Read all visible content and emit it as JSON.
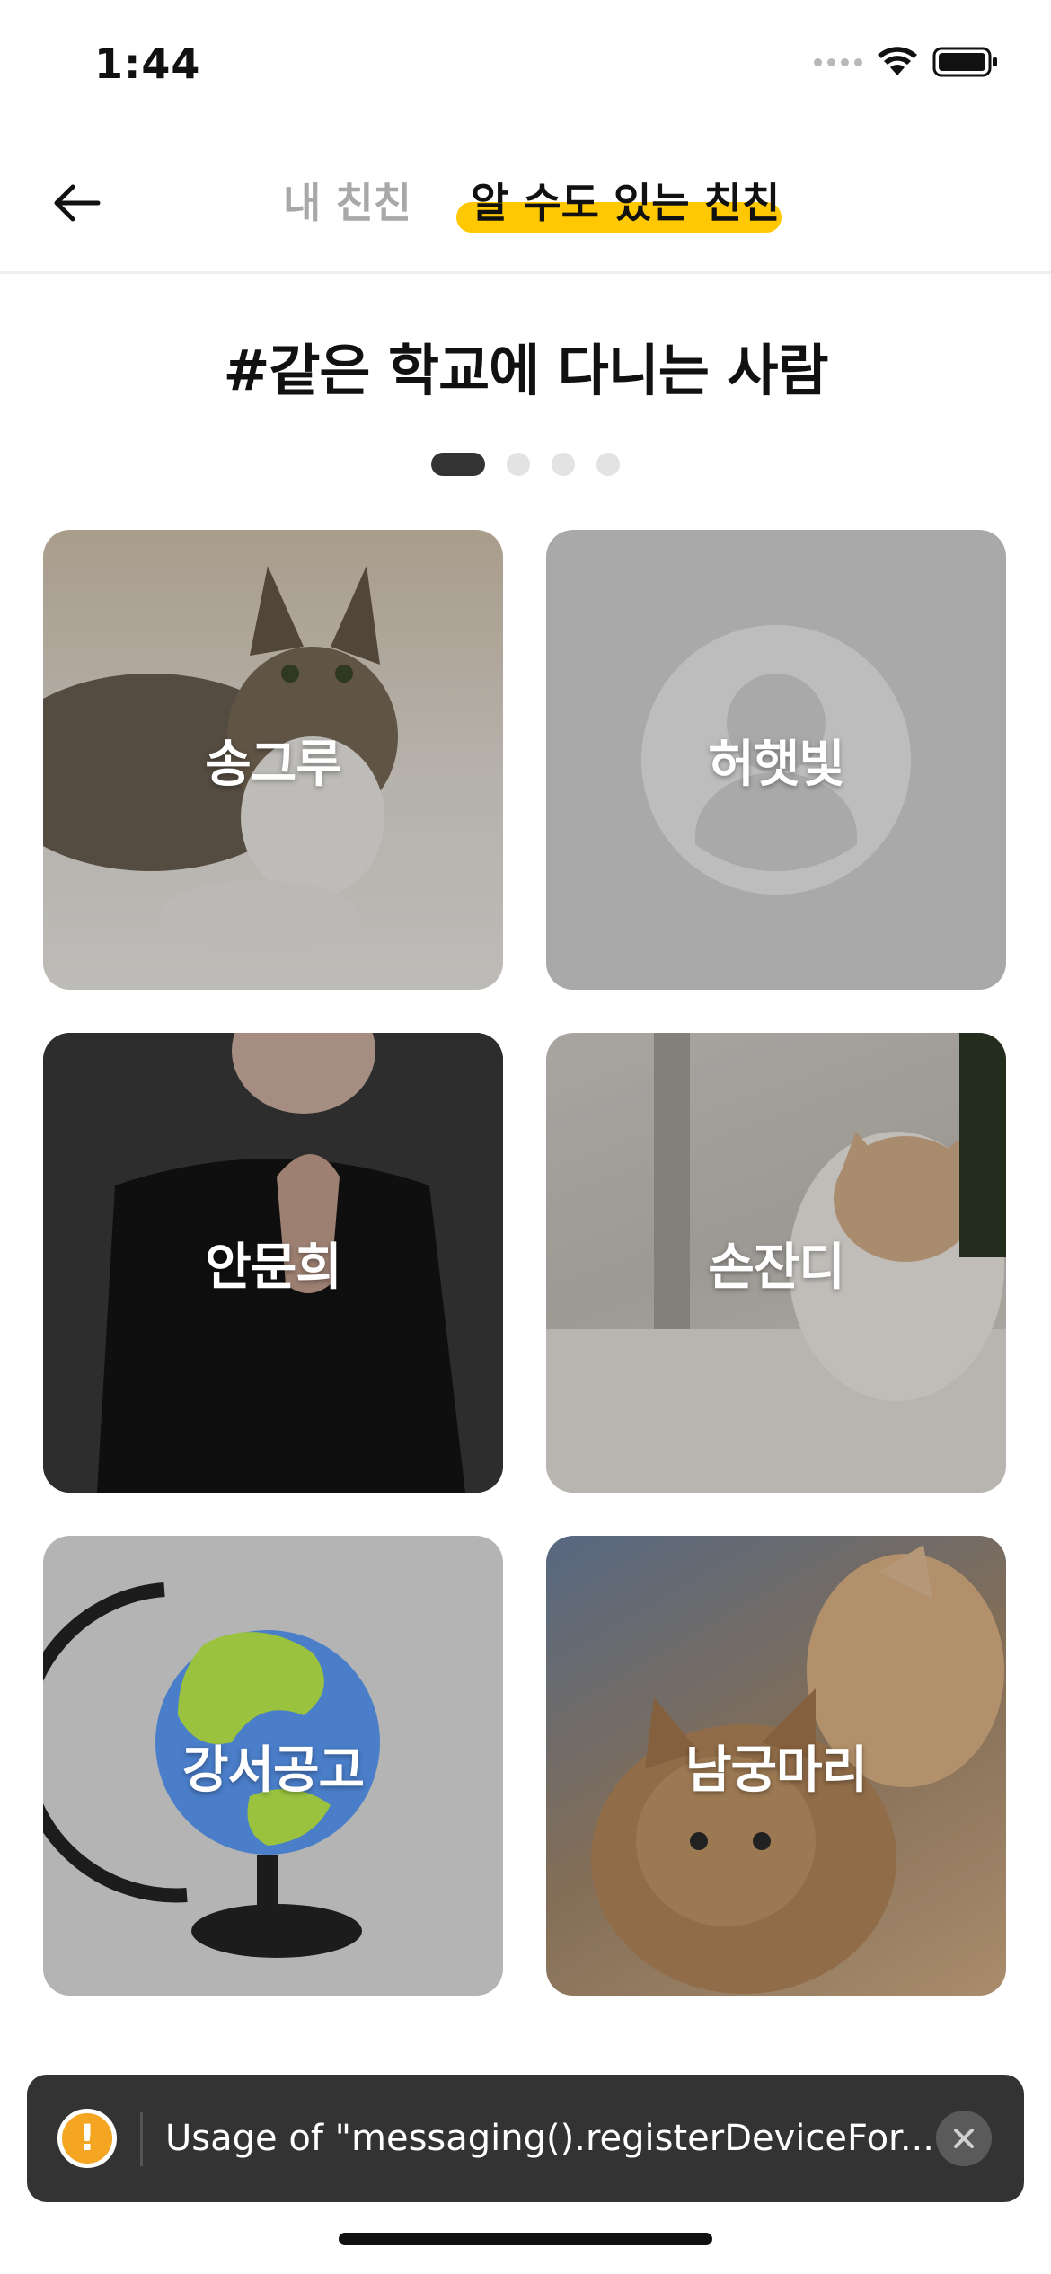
{
  "status_bar": {
    "time": "1:44",
    "icons": [
      "cellular-signal-icon",
      "wifi-icon",
      "battery-icon"
    ]
  },
  "header": {
    "back_icon": "arrow-left-icon",
    "tabs": [
      {
        "label": "내 친친",
        "active": false
      },
      {
        "label": "알 수도 있는 친친",
        "active": true
      }
    ],
    "active_color": "#ffc801"
  },
  "section": {
    "title": "#같은 학교에 다니는 사람",
    "pages": 4,
    "current_page": 1
  },
  "cards": [
    {
      "name": "송그루",
      "image": "tabby-cat-photo"
    },
    {
      "name": "허햇빛",
      "image": "default-avatar-icon"
    },
    {
      "name": "안문희",
      "image": "person-photo"
    },
    {
      "name": "손잔디",
      "image": "white-cat-photo"
    },
    {
      "name": "강서공고",
      "image": "globe-illustration"
    },
    {
      "name": "남궁마리",
      "image": "kittens-photo"
    }
  ],
  "toast": {
    "icon": "warning-icon",
    "message": "Usage of \"messaging().registerDeviceFor...",
    "close_icon": "close-icon"
  }
}
